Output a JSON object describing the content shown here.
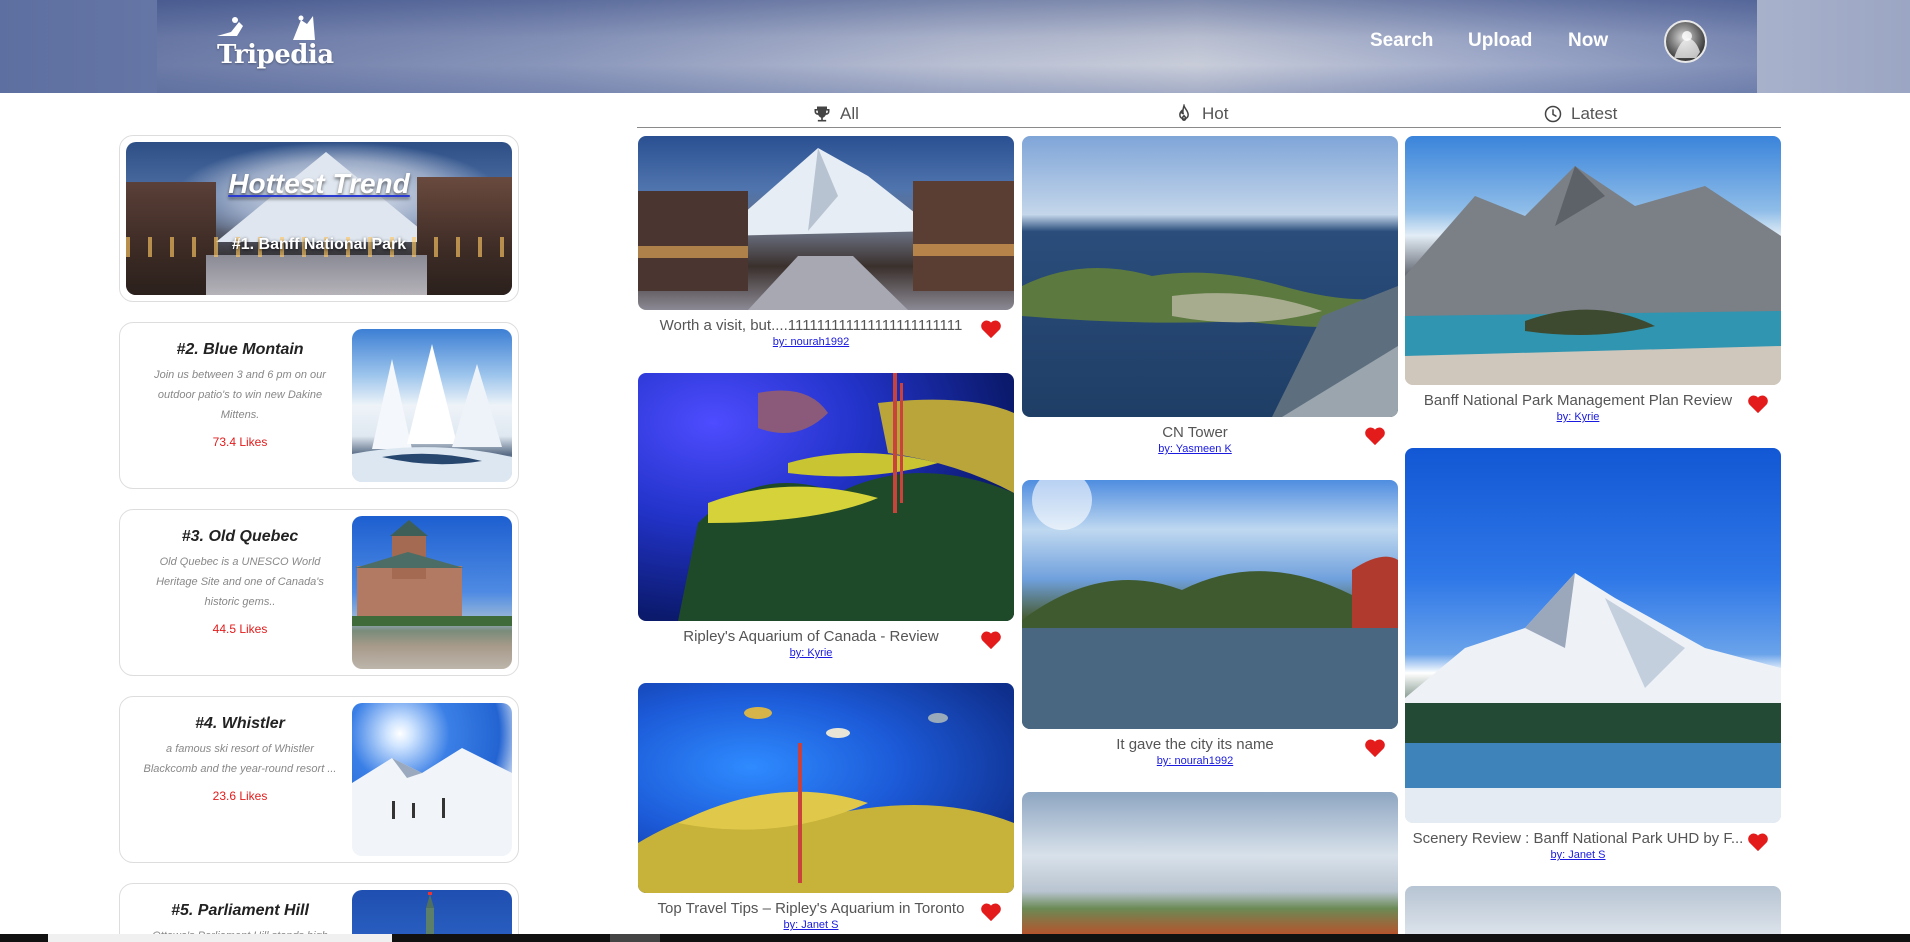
{
  "app": {
    "name": "Tripedia"
  },
  "nav": {
    "search": "Search",
    "upload": "Upload",
    "now": "Now"
  },
  "tabs": [
    {
      "label": "All",
      "icon": "trophy-icon"
    },
    {
      "label": "Hot",
      "icon": "flame-icon"
    },
    {
      "label": "Latest",
      "icon": "clock-icon"
    }
  ],
  "trending": {
    "hero": {
      "title": "Hottest Trend",
      "subtitle": "#1. Banff National Park"
    },
    "items": [
      {
        "name": "#2. Blue Montain",
        "desc": "Join us between 3 and 6 pm on our outdoor patio's to win new Dakine Mittens.",
        "likes": "73.4 Likes"
      },
      {
        "name": "#3. Old Quebec",
        "desc": "Old Quebec is a UNESCO World Heritage Site and one of Canada's historic gems..",
        "likes": "44.5 Likes"
      },
      {
        "name": "#4. Whistler",
        "desc": "a famous ski resort of Whistler Blackcomb and the year-round resort ...",
        "likes": "23.6 Likes"
      },
      {
        "name": "#5. Parliament Hill",
        "desc": "Ottawa's Parliament Hill stands high",
        "likes": ""
      }
    ]
  },
  "posts": [
    {
      "title": "Worth a visit, but....111111111111111111111111",
      "author": "by: nourah1992"
    },
    {
      "title": "Ripley's Aquarium of Canada - Review",
      "author": "by: Kyrie"
    },
    {
      "title": "Top Travel Tips – Ripley's Aquarium in Toronto",
      "author": "by: Janet S"
    },
    {
      "title": "CN Tower",
      "author": "by: Yasmeen K"
    },
    {
      "title": "It gave the city its name",
      "author": "by: nourah1992"
    },
    {
      "title": "Banff National Park Management Plan Review",
      "author": "by: Kyrie"
    },
    {
      "title": "Scenery Review : Banff National Park UHD by F...",
      "author": "by: Janet S"
    }
  ],
  "colors": {
    "likes": "#e31b1b",
    "author_link": "#1a1ae0",
    "heart": "#e31b1b"
  }
}
